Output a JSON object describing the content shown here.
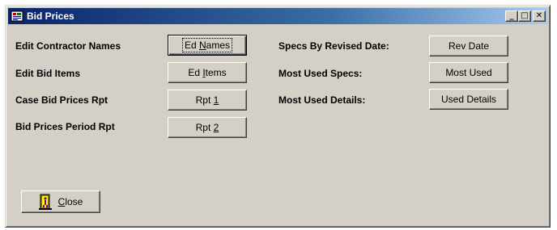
{
  "window": {
    "title": "Bid Prices",
    "controls": {
      "minimize": "_",
      "maximize": "□",
      "close": "✕"
    }
  },
  "left_rows": [
    {
      "label": "Edit Contractor Names",
      "btn_pre": "Ed ",
      "btn_key": "N",
      "btn_post": "ames"
    },
    {
      "label": "Edit Bid Items",
      "btn_pre": "Ed ",
      "btn_key": "I",
      "btn_post": "tems"
    },
    {
      "label": "Case Bid Prices Rpt",
      "btn_pre": "Rpt ",
      "btn_key": "1",
      "btn_post": ""
    },
    {
      "label": "Bid Prices Period Rpt",
      "btn_pre": "Rpt ",
      "btn_key": "2",
      "btn_post": ""
    }
  ],
  "right_rows": [
    {
      "label": "Specs By Revised Date:",
      "button": "Rev Date"
    },
    {
      "label": "Most Used Specs:",
      "button": "Most Used"
    },
    {
      "label": "Most Used Details:",
      "button": "Used Details"
    }
  ],
  "close_button": {
    "key": "C",
    "rest": "lose",
    "icon": "door-exit-icon"
  },
  "colors": {
    "face": "#d4d0c8",
    "title_start": "#0a246a",
    "title_end": "#a6caf0"
  }
}
